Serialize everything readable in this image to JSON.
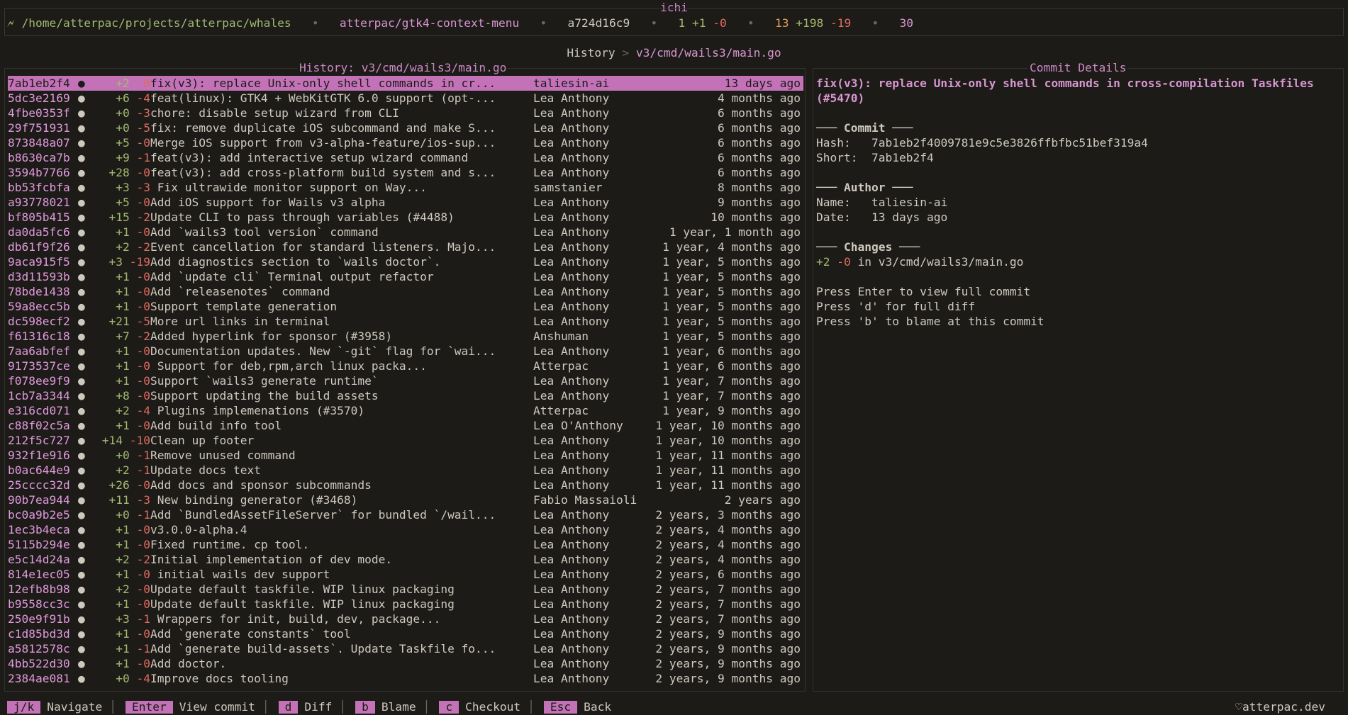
{
  "app_title": "ichi",
  "status": {
    "path": "/home/atterpac/projects/atterpac/whales",
    "branch": "atterpac/gtk4-context-menu",
    "commit": "a724d16c9",
    "ahead": "1",
    "staged_add": "+1",
    "staged_del": "-0",
    "changed_files": "13",
    "lines_add": "+198",
    "lines_del": "-19",
    "count": "30",
    "sep": "•"
  },
  "breadcrumb": {
    "root": "History",
    "sep": ">",
    "path": "v3/cmd/wails3/main.go"
  },
  "history_panel": {
    "title": "History: v3/cmd/wails3/main.go",
    "commits": [
      {
        "hash": "7ab1eb2f4",
        "add": "+2",
        "del": "-0",
        "msg": "fix(v3): replace Unix-only shell commands in cr...",
        "author": "taliesin-ai",
        "date": "13 days ago"
      },
      {
        "hash": "5dc3e2169",
        "add": "+6",
        "del": "-4",
        "msg": "feat(linux): GTK4 + WebKitGTK 6.0 support (opt-...",
        "author": "Lea Anthony",
        "date": "4 months ago"
      },
      {
        "hash": "4fbe0353f",
        "add": "+0",
        "del": "-3",
        "msg": "chore: disable setup wizard from CLI",
        "author": "Lea Anthony",
        "date": "6 months ago"
      },
      {
        "hash": "29f751931",
        "add": "+0",
        "del": "-5",
        "msg": "fix: remove duplicate iOS subcommand and make S...",
        "author": "Lea Anthony",
        "date": "6 months ago"
      },
      {
        "hash": "873848a07",
        "add": "+5",
        "del": "-0",
        "msg": "Merge iOS support from v3-alpha-feature/ios-sup...",
        "author": "Lea Anthony",
        "date": "6 months ago"
      },
      {
        "hash": "b8630ca7b",
        "add": "+9",
        "del": "-1",
        "msg": "feat(v3): add interactive setup wizard command",
        "author": "Lea Anthony",
        "date": "6 months ago"
      },
      {
        "hash": "3594b7766",
        "add": "+28",
        "del": "-0",
        "msg": "feat(v3): add cross-platform build system and s...",
        "author": "Lea Anthony",
        "date": "6 months ago"
      },
      {
        "hash": "bb53fcbfa",
        "add": "+3",
        "del": "-3",
        "msg": " Fix ultrawide monitor support on Way...",
        "author": "samstanier",
        "date": "8 months ago"
      },
      {
        "hash": "a93778021",
        "add": "+5",
        "del": "-0",
        "msg": "Add iOS support for Wails v3 alpha",
        "author": "Lea Anthony",
        "date": "9 months ago"
      },
      {
        "hash": "bf805b415",
        "add": "+15",
        "del": "-2",
        "msg": "Update CLI to pass through variables (#4488)",
        "author": "Lea Anthony",
        "date": "10 months ago"
      },
      {
        "hash": "da0da5fc6",
        "add": "+1",
        "del": "-0",
        "msg": "Add `wails3 tool version` command",
        "author": "Lea Anthony",
        "date": "1 year, 1 month ago"
      },
      {
        "hash": "db61f9f26",
        "add": "+2",
        "del": "-2",
        "msg": "Event cancellation for standard listeners. Majo...",
        "author": "Lea Anthony",
        "date": "1 year, 4 months ago"
      },
      {
        "hash": "9aca915f5",
        "add": "+3",
        "del": "-19",
        "msg": "Add diagnostics section to `wails doctor`.",
        "author": "Lea Anthony",
        "date": "1 year, 5 months ago"
      },
      {
        "hash": "d3d11593b",
        "add": "+1",
        "del": "-0",
        "msg": "Add `update cli` Terminal output refactor",
        "author": "Lea Anthony",
        "date": "1 year, 5 months ago"
      },
      {
        "hash": "78bde1438",
        "add": "+1",
        "del": "-0",
        "msg": "Add `releasenotes` command",
        "author": "Lea Anthony",
        "date": "1 year, 5 months ago"
      },
      {
        "hash": "59a8ecc5b",
        "add": "+1",
        "del": "-0",
        "msg": "Support template generation",
        "author": "Lea Anthony",
        "date": "1 year, 5 months ago"
      },
      {
        "hash": "dc598ecf2",
        "add": "+21",
        "del": "-5",
        "msg": "More url links in terminal",
        "author": "Lea Anthony",
        "date": "1 year, 5 months ago"
      },
      {
        "hash": "f61316c18",
        "add": "+7",
        "del": "-2",
        "msg": "Added hyperlink for sponsor (#3958)",
        "author": "Anshuman",
        "date": "1 year, 5 months ago"
      },
      {
        "hash": "7aa6abfef",
        "add": "+1",
        "del": "-0",
        "msg": "Documentation updates. New `-git` flag for `wai...",
        "author": "Lea Anthony",
        "date": "1 year, 6 months ago"
      },
      {
        "hash": "9173537ce",
        "add": "+1",
        "del": "-0",
        "msg": " Support for deb,rpm,arch linux packa...",
        "author": "Atterpac",
        "date": "1 year, 6 months ago"
      },
      {
        "hash": "f078ee9f9",
        "add": "+1",
        "del": "-0",
        "msg": "Support `wails3 generate runtime`",
        "author": "Lea Anthony",
        "date": "1 year, 7 months ago"
      },
      {
        "hash": "1cb7a3344",
        "add": "+8",
        "del": "-0",
        "msg": "Support updating the build assets",
        "author": "Lea Anthony",
        "date": "1 year, 7 months ago"
      },
      {
        "hash": "e316cd071",
        "add": "+2",
        "del": "-4",
        "msg": " Plugins implemenations (#3570)",
        "author": "Atterpac",
        "date": "1 year, 9 months ago"
      },
      {
        "hash": "c88f02c5a",
        "add": "+1",
        "del": "-0",
        "msg": "Add build info tool",
        "author": "Lea O'Anthony",
        "date": "1 year, 10 months ago"
      },
      {
        "hash": "212f5c727",
        "add": "+14",
        "del": "-10",
        "msg": "Clean up footer",
        "author": "Lea Anthony",
        "date": "1 year, 10 months ago"
      },
      {
        "hash": "932f1e916",
        "add": "+0",
        "del": "-1",
        "msg": "Remove unused command",
        "author": "Lea Anthony",
        "date": "1 year, 11 months ago"
      },
      {
        "hash": "b0ac644e9",
        "add": "+2",
        "del": "-1",
        "msg": "Update docs text",
        "author": "Lea Anthony",
        "date": "1 year, 11 months ago"
      },
      {
        "hash": "25cccc32d",
        "add": "+26",
        "del": "-0",
        "msg": "Add docs and sponsor subcommands",
        "author": "Lea Anthony",
        "date": "1 year, 11 months ago"
      },
      {
        "hash": "90b7ea944",
        "add": "+11",
        "del": "-3",
        "msg": " New binding generator (#3468)",
        "author": "Fabio Massaioli",
        "date": "2 years ago"
      },
      {
        "hash": "bc0a9b2e5",
        "add": "+0",
        "del": "-1",
        "msg": "Add `BundledAssetFileServer` for bundled `/wail...",
        "author": "Lea Anthony",
        "date": "2 years, 3 months ago"
      },
      {
        "hash": "1ec3b4eca",
        "add": "+1",
        "del": "-0",
        "msg": "v3.0.0-alpha.4",
        "author": "Lea Anthony",
        "date": "2 years, 4 months ago"
      },
      {
        "hash": "5115b294e",
        "add": "+1",
        "del": "-0",
        "msg": "Fixed runtime. cp tool.",
        "author": "Lea Anthony",
        "date": "2 years, 4 months ago"
      },
      {
        "hash": "e5c14d24a",
        "add": "+2",
        "del": "-2",
        "msg": "Initial implementation of dev mode.",
        "author": "Lea Anthony",
        "date": "2 years, 4 months ago"
      },
      {
        "hash": "814e1ec05",
        "add": "+1",
        "del": "-0",
        "msg": " initial wails dev support",
        "author": "Lea Anthony",
        "date": "2 years, 6 months ago"
      },
      {
        "hash": "12efb8b98",
        "add": "+2",
        "del": "-0",
        "msg": "Update default taskfile. WIP linux packaging",
        "author": "Lea Anthony",
        "date": "2 years, 7 months ago"
      },
      {
        "hash": "b9558cc3c",
        "add": "+1",
        "del": "-0",
        "msg": "Update default taskfile. WIP linux packaging",
        "author": "Lea Anthony",
        "date": "2 years, 7 months ago"
      },
      {
        "hash": "250e9f91b",
        "add": "+3",
        "del": "-1",
        "msg": " Wrappers for init, build, dev, package...",
        "author": "Lea Anthony",
        "date": "2 years, 7 months ago"
      },
      {
        "hash": "c1d85bd3d",
        "add": "+1",
        "del": "-0",
        "msg": "Add `generate constants` tool",
        "author": "Lea Anthony",
        "date": "2 years, 9 months ago"
      },
      {
        "hash": "a5812578c",
        "add": "+1",
        "del": "-1",
        "msg": "Add `generate build-assets`. Update Taskfile fo...",
        "author": "Lea Anthony",
        "date": "2 years, 9 months ago"
      },
      {
        "hash": "4bb522d30",
        "add": "+1",
        "del": "-0",
        "msg": "Add doctor.",
        "author": "Lea Anthony",
        "date": "2 years, 9 months ago"
      },
      {
        "hash": "2384ae081",
        "add": "+0",
        "del": "-4",
        "msg": "Improve docs tooling",
        "author": "Lea Anthony",
        "date": "2 years, 9 months ago"
      }
    ]
  },
  "details_panel": {
    "title": "Commit Details",
    "subject": "fix(v3): replace Unix-only shell commands in cross-compilation Taskfiles (#5470)",
    "commit_header": "─── Commit ───",
    "hash_label": "Hash:",
    "hash_value": "7ab1eb2f4009781e9c5e3826ffbfbc51bef319a4",
    "short_label": "Short:",
    "short_value": "7ab1eb2f4",
    "author_header": "─── Author ───",
    "name_label": "Name:",
    "name_value": "taliesin-ai",
    "date_label": "Date:",
    "date_value": "13 days ago",
    "changes_header": "─── Changes ───",
    "changes_add": "+2",
    "changes_del": "-0",
    "changes_in": "in v3/cmd/wails3/main.go",
    "hint1": "Press Enter to view full commit",
    "hint2": "Press 'd' for full diff",
    "hint3": "Press 'b' to blame at this commit"
  },
  "footer": {
    "keys": [
      {
        "key": "j/k",
        "label": "Navigate"
      },
      {
        "key": "Enter",
        "label": "View commit"
      },
      {
        "key": "d",
        "label": "Diff"
      },
      {
        "key": "b",
        "label": "Blame"
      },
      {
        "key": "c",
        "label": "Checkout"
      },
      {
        "key": "Esc",
        "label": "Back"
      }
    ],
    "sep": "│",
    "brand": "atterpac.dev"
  },
  "icons": {
    "plug": "plug-icon",
    "heart": "heart-icon",
    "commit_dot": "commit-dot-icon"
  },
  "colors": {
    "accent": "#c372b7",
    "add": "#a4b96f",
    "del": "#e06c5e",
    "hash": "#e19adc",
    "background": "#1c1b18"
  }
}
